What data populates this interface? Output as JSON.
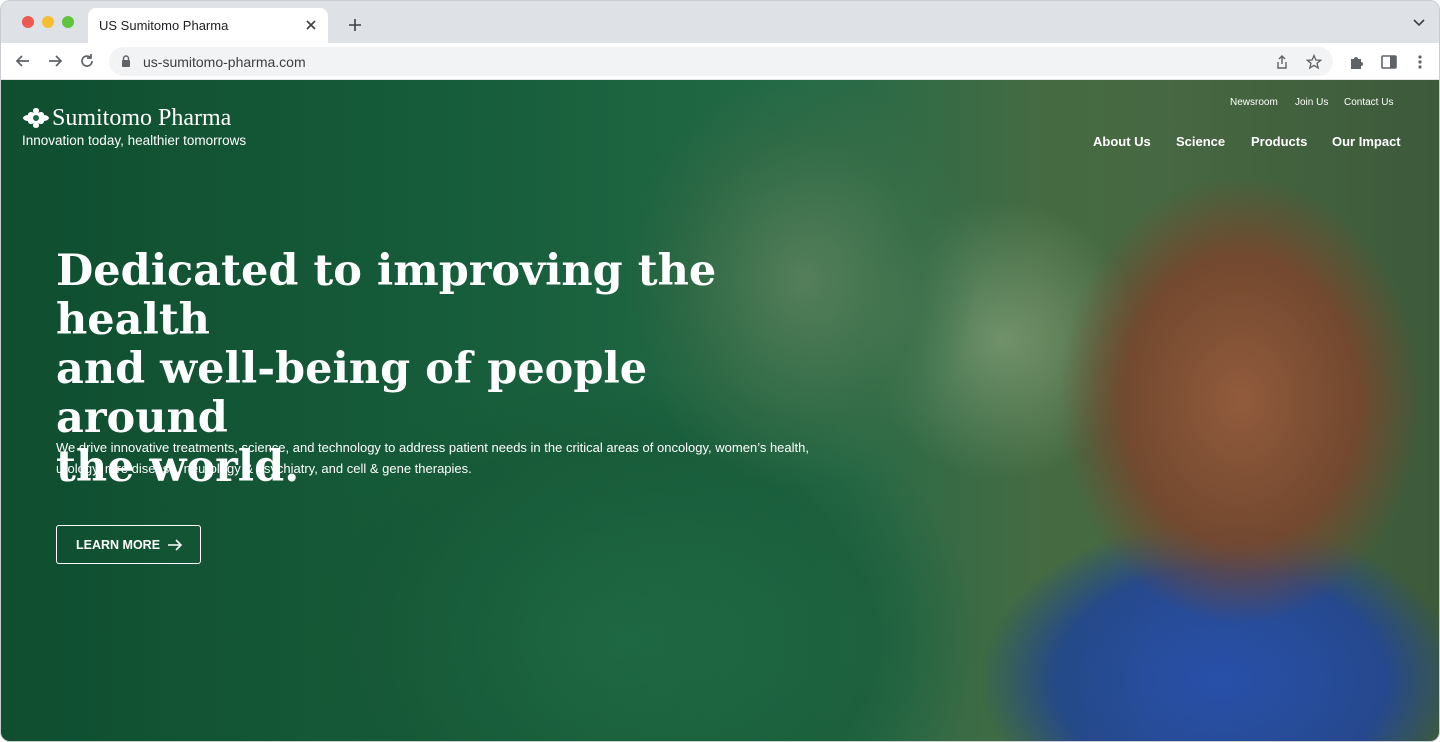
{
  "browser": {
    "tab_title": "US Sumitomo Pharma",
    "url": "us-sumitomo-pharma.com"
  },
  "site": {
    "logo_name": "Sumitomo Pharma",
    "tagline": "Innovation today, healthier tomorrows",
    "utility_nav": [
      "Newsroom",
      "Join Us",
      "Contact Us"
    ],
    "main_nav": [
      "About Us",
      "Science",
      "Products",
      "Our Impact"
    ]
  },
  "hero": {
    "title_lines": [
      "Dedicated to improving the health",
      "and well-being of people around",
      "the world."
    ],
    "body_lines": [
      "We drive innovative treatments, science, and technology to address patient needs in the critical areas of oncology, women’s health,",
      "urology, rare disease, neurology & psychiatry, and cell & gene therapies."
    ],
    "cta_label": "LEARN MORE"
  },
  "icons": {
    "tab_close": "close-icon",
    "new_tab": "plus-icon",
    "back": "arrow-left-icon",
    "forward": "arrow-right-icon",
    "reload": "reload-icon",
    "lock": "lock-icon",
    "share": "share-icon",
    "bookmark": "star-icon",
    "extensions": "puzzle-icon",
    "side_panel": "side-panel-icon",
    "menu": "kebab-menu-icon"
  },
  "colors": {
    "brand_overlay": "#16593a",
    "text_on_hero": "#ffffff"
  }
}
